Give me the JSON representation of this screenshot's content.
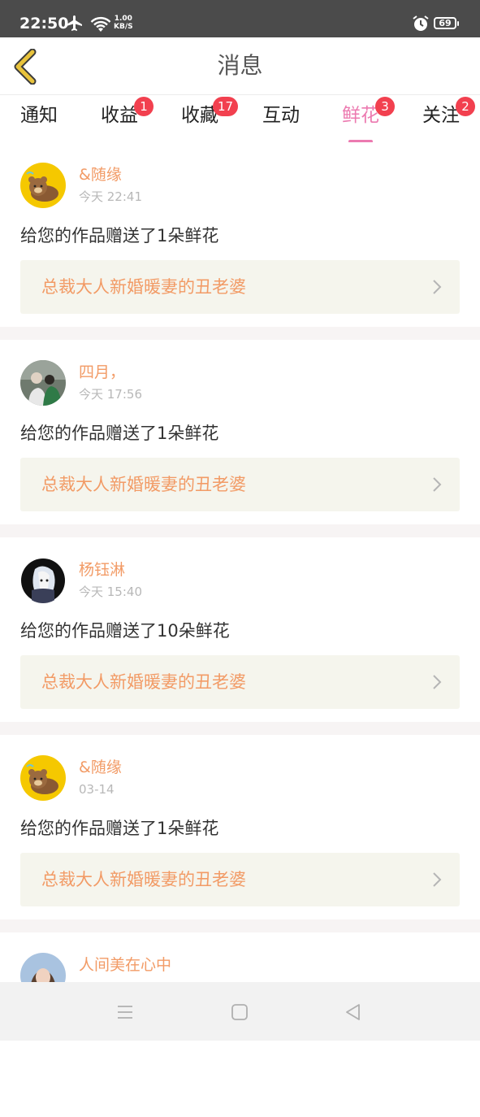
{
  "status_bar": {
    "time": "22:50",
    "net_speed_value": "1.00",
    "net_speed_unit": "KB/S",
    "battery": "69"
  },
  "header": {
    "title": "消息"
  },
  "tabs": [
    {
      "label": "通知",
      "badge": ""
    },
    {
      "label": "收益",
      "badge": "1"
    },
    {
      "label": "收藏",
      "badge": "17"
    },
    {
      "label": "互动",
      "badge": ""
    },
    {
      "label": "鲜花",
      "badge": "3",
      "active": true
    },
    {
      "label": "关注",
      "badge": "2"
    }
  ],
  "messages": [
    {
      "username": "&随缘",
      "time": "今天 22:41",
      "text": "给您的作品赠送了1朵鲜花",
      "work_title": "总裁大人新婚暖妻的丑老婆",
      "avatar": "bear-avatar"
    },
    {
      "username": "四月，",
      "time": "今天 17:56",
      "text": "给您的作品赠送了1朵鲜花",
      "work_title": "总裁大人新婚暖妻的丑老婆",
      "avatar": "couple-photo-avatar"
    },
    {
      "username": "杨钰淋",
      "time": "今天 15:40",
      "text": "给您的作品赠送了10朵鲜花",
      "work_title": "总裁大人新婚暖妻的丑老婆",
      "avatar": "anime-dark-avatar"
    },
    {
      "username": "&随缘",
      "time": "03-14",
      "text": "给您的作品赠送了1朵鲜花",
      "work_title": "总裁大人新婚暖妻的丑老婆",
      "avatar": "bear-avatar"
    },
    {
      "username": "人间美在心中",
      "time": "",
      "text": "",
      "work_title": "",
      "avatar": "woman-photo-avatar"
    }
  ],
  "colors": {
    "accent": "#ec7ab0",
    "orange": "#f29b66",
    "badge": "#f2404f",
    "back_icon": "#e8c33c"
  }
}
